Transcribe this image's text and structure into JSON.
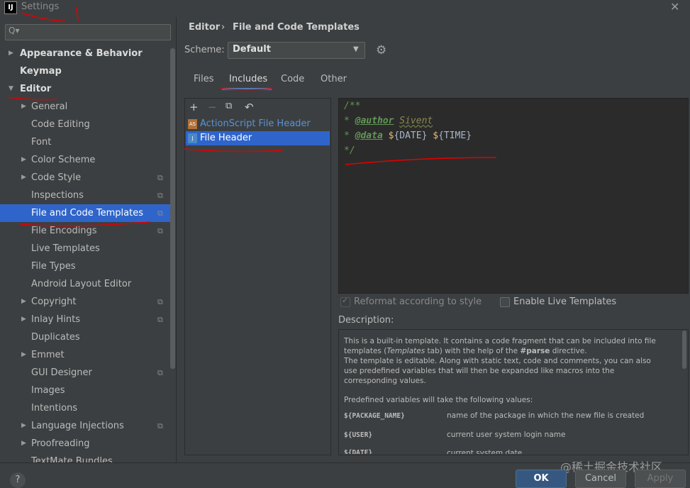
{
  "window": {
    "title": "Settings",
    "app_icon": "intellij-icon",
    "close_glyph": "✕"
  },
  "search": {
    "placeholder": "",
    "icon_glyph": "Q▾"
  },
  "sidebar": {
    "items": [
      {
        "label": "Appearance & Behavior",
        "level": 0,
        "expandable": true,
        "bold": true
      },
      {
        "label": "Keymap",
        "level": 0,
        "expandable": false,
        "bold": true
      },
      {
        "label": "Editor",
        "level": 0,
        "expandable": true,
        "expanded": true,
        "bold": true
      },
      {
        "label": "General",
        "level": 1,
        "expandable": true
      },
      {
        "label": "Code Editing",
        "level": 1
      },
      {
        "label": "Font",
        "level": 1
      },
      {
        "label": "Color Scheme",
        "level": 1,
        "expandable": true
      },
      {
        "label": "Code Style",
        "level": 1,
        "expandable": true,
        "project_icon": true
      },
      {
        "label": "Inspections",
        "level": 1,
        "project_icon": true
      },
      {
        "label": "File and Code Templates",
        "level": 1,
        "project_icon": true,
        "selected": true
      },
      {
        "label": "File Encodings",
        "level": 1,
        "project_icon": true
      },
      {
        "label": "Live Templates",
        "level": 1
      },
      {
        "label": "File Types",
        "level": 1
      },
      {
        "label": "Android Layout Editor",
        "level": 1
      },
      {
        "label": "Copyright",
        "level": 1,
        "expandable": true,
        "project_icon": true
      },
      {
        "label": "Inlay Hints",
        "level": 1,
        "expandable": true,
        "project_icon": true
      },
      {
        "label": "Duplicates",
        "level": 1
      },
      {
        "label": "Emmet",
        "level": 1,
        "expandable": true
      },
      {
        "label": "GUI Designer",
        "level": 1,
        "project_icon": true
      },
      {
        "label": "Images",
        "level": 1
      },
      {
        "label": "Intentions",
        "level": 1
      },
      {
        "label": "Language Injections",
        "level": 1,
        "expandable": true,
        "project_icon": true
      },
      {
        "label": "Proofreading",
        "level": 1,
        "expandable": true
      },
      {
        "label": "TextMate Bundles",
        "level": 1
      }
    ]
  },
  "breadcrumb": {
    "parent": "Editor",
    "separator": "›",
    "current": "File and Code Templates"
  },
  "scheme": {
    "label": "Scheme:",
    "value": "Default"
  },
  "tabs": [
    {
      "label": "Files",
      "active": false
    },
    {
      "label": "Includes",
      "active": true
    },
    {
      "label": "Code",
      "active": false
    },
    {
      "label": "Other",
      "active": false
    }
  ],
  "toolbar": {
    "add": "+",
    "remove": "−",
    "copy": "⧉",
    "reset": "↶"
  },
  "templates": [
    {
      "label": "ActionScript File Header",
      "icon_text": "AS",
      "selected": false
    },
    {
      "label": "File Header",
      "icon_text": "J",
      "selected": true
    }
  ],
  "editor": {
    "line1": "/**",
    "line2_prefix": "* ",
    "line2_tag": "@author",
    "line2_value": "Sivent",
    "line3_prefix": "* ",
    "line3_tag": "@data",
    "line3_var1": "${DATE}",
    "line3_var2": "${TIME}",
    "line4": "*/"
  },
  "options": {
    "reformat": {
      "label": "Reformat according to style",
      "checked": true,
      "enabled": false
    },
    "live_templates": {
      "label": "Enable Live Templates",
      "checked": false
    }
  },
  "description": {
    "label": "Description:",
    "p1_a": "This is a built-in template. It contains a code fragment that can be included into file templates (",
    "p1_italic": "Templates",
    "p1_b": " tab) with the help of the ",
    "p1_bold": "#parse",
    "p1_c": " directive.",
    "p2": "The template is editable. Along with static text, code and comments, you can also use predefined variables that will then be expanded like macros into the corresponding values.",
    "p3": "Predefined variables will take the following values:",
    "vars": [
      {
        "name": "${PACKAGE_NAME}",
        "desc": "name of the package in which the new file is created"
      },
      {
        "name": "${USER}",
        "desc": "current user system login name"
      },
      {
        "name": "${DATE}",
        "desc": "current system date"
      }
    ]
  },
  "buttons": {
    "help": "?",
    "ok": "OK",
    "cancel": "Cancel",
    "apply": "Apply"
  },
  "watermark": "@稀土掘金技术社区",
  "colors": {
    "selection": "#2f65ca",
    "accent_tab": "#4a88c7",
    "annotation": "#e00000",
    "ok_button": "#365880"
  }
}
